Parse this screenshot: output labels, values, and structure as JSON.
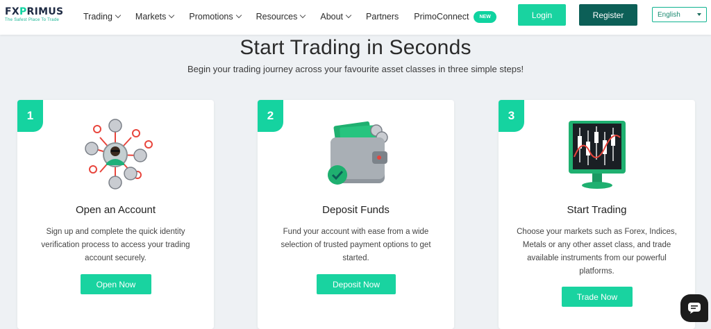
{
  "brand": {
    "logo_prefix": "FX",
    "logo_x": "P",
    "logo_suffix": "RIMUS",
    "tagline": "The Safest Place To Trade"
  },
  "nav": {
    "items": [
      {
        "label": "Trading",
        "has_dropdown": true
      },
      {
        "label": "Markets",
        "has_dropdown": true
      },
      {
        "label": "Promotions",
        "has_dropdown": true
      },
      {
        "label": "Resources",
        "has_dropdown": true
      },
      {
        "label": "About",
        "has_dropdown": true
      },
      {
        "label": "Partners",
        "has_dropdown": false
      },
      {
        "label": "PrimoConnect",
        "has_dropdown": false
      }
    ],
    "new_badge": "NEW",
    "login": "Login",
    "register": "Register",
    "language": "English"
  },
  "hero": {
    "title": "Start Trading in Seconds",
    "subtitle": "Begin your trading journey across your favourite asset classes in three simple steps!"
  },
  "cards": [
    {
      "step": "1",
      "title": "Open an Account",
      "description": "Sign up and complete the quick identity verification process to access your trading account securely.",
      "button": "Open Now",
      "icon": "network-avatar-icon"
    },
    {
      "step": "2",
      "title": "Deposit Funds",
      "description": "Fund your account with ease from a wide selection of trusted payment options to get started.",
      "button": "Deposit Now",
      "icon": "wallet-icon"
    },
    {
      "step": "3",
      "title": "Start Trading",
      "description": "Choose your markets such as Forex, Indices, Metals or any other asset class, and trade available instruments from our powerful platforms.",
      "button": "Trade Now",
      "icon": "trading-monitor-icon"
    }
  ],
  "colors": {
    "accent": "#19d3a0",
    "dark_teal": "#0c5f57",
    "page_bg": "#eef1f4",
    "chat_bg": "#1c1c1c"
  },
  "chat": {
    "icon": "chat-icon"
  }
}
